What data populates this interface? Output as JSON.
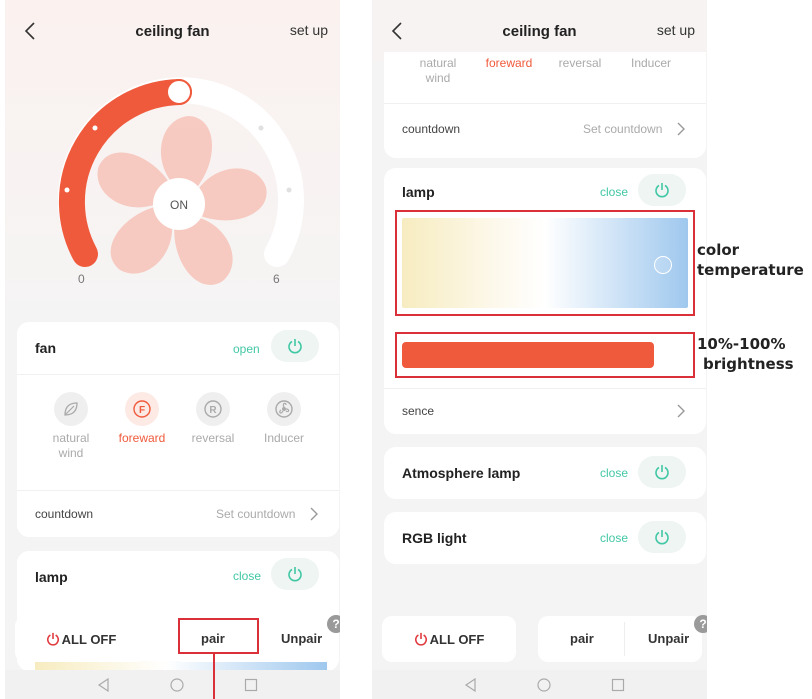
{
  "left": {
    "header": {
      "title": "ceiling fan",
      "setup": "set up"
    },
    "dial": {
      "center": "ON",
      "min": "0",
      "max": "6"
    },
    "fan": {
      "title": "fan",
      "state": "open",
      "modes": [
        {
          "label": "natural wind",
          "active": false,
          "icon": "leaf-icon"
        },
        {
          "label": "foreward",
          "active": true,
          "icon": "forward-f-icon"
        },
        {
          "label": "reversal",
          "active": false,
          "icon": "reversal-r-icon"
        },
        {
          "label": "Inducer",
          "active": false,
          "icon": "inducer-fan-icon"
        }
      ],
      "countdown_label": "countdown",
      "countdown_value": "Set countdown"
    },
    "lamp": {
      "title": "lamp",
      "state": "close"
    },
    "bottom": {
      "all_off": "ALL OFF",
      "pair": "pair",
      "unpair": "Unpair",
      "help": "?"
    }
  },
  "right": {
    "header": {
      "title": "ceiling fan",
      "setup": "set up"
    },
    "modes": [
      {
        "label": "natural wind",
        "active": false
      },
      {
        "label": "foreward",
        "active": true
      },
      {
        "label": "reversal",
        "active": false
      },
      {
        "label": "Inducer",
        "active": false
      }
    ],
    "countdown_label": "countdown",
    "countdown_value": "Set countdown",
    "lamp": {
      "title": "lamp",
      "state": "close",
      "sence": "sence"
    },
    "atmosphere": {
      "title": "Atmosphere lamp",
      "state": "close"
    },
    "rgb": {
      "title": "RGB light",
      "state": "close"
    },
    "bottom": {
      "all_off": "ALL OFF",
      "pair": "pair",
      "unpair": "Unpair",
      "help": "?"
    }
  },
  "annotations": {
    "color_temp_line1": "color",
    "color_temp_line2": "temperature",
    "brightness_line1": "10%-100%",
    "brightness_line2": "brightness"
  },
  "colors": {
    "accent": "#f05a3c",
    "green": "#42c7a5",
    "annotation_red": "#d9303a",
    "warm": "#f7ecc0",
    "cool": "#9fc8ee"
  }
}
